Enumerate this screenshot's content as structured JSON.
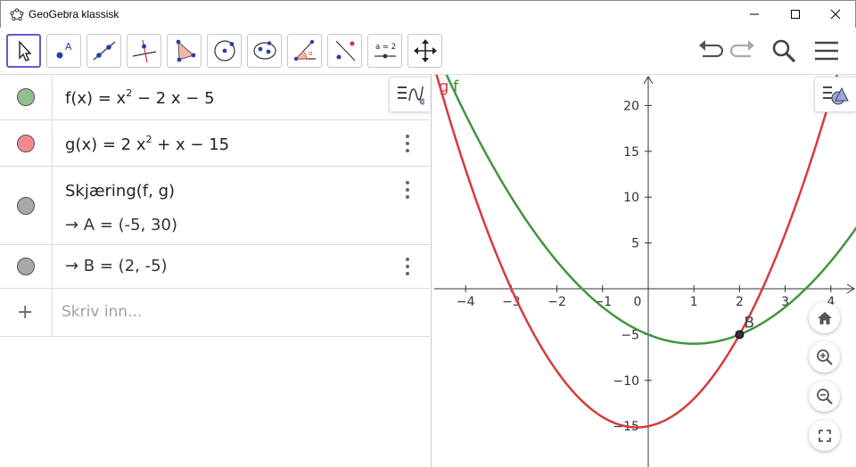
{
  "window": {
    "title": "GeoGebra klassisk"
  },
  "toolbar": {
    "tools": [
      {
        "name": "move-tool",
        "icon": "arrow-cursor-icon"
      },
      {
        "name": "point-tool",
        "icon": "point-icon"
      },
      {
        "name": "line-tool",
        "icon": "line-icon"
      },
      {
        "name": "perpendicular-line-tool",
        "icon": "perpendicular-icon"
      },
      {
        "name": "polygon-tool",
        "icon": "polygon-icon"
      },
      {
        "name": "circle-tool",
        "icon": "circle-icon"
      },
      {
        "name": "ellipse-tool",
        "icon": "ellipse-icon"
      },
      {
        "name": "angle-tool",
        "icon": "angle-icon"
      },
      {
        "name": "reflect-tool",
        "icon": "reflect-icon"
      },
      {
        "name": "slider-tool",
        "icon": "slider-icon",
        "label": "a = 2"
      },
      {
        "name": "move-graphics-tool",
        "icon": "move-view-icon"
      }
    ]
  },
  "algebra": {
    "rows": [
      {
        "color": "#90c08f",
        "name": "f",
        "expr_prefix": "f(x)  =  x",
        "expr_sup": "2",
        "expr_suffix": " − 2 x − 5"
      },
      {
        "color": "#f08b8b",
        "name": "g",
        "expr_prefix": "g(x)  =  2 x",
        "expr_sup": "2",
        "expr_suffix": " + x − 15"
      },
      {
        "color": "#a8a8a8",
        "name": "intersect",
        "expr": "Skjæring(f, g)",
        "result": "→ A = (-5, 30)"
      },
      {
        "color": "#a8a8a8",
        "name": "B",
        "expr": "→ B = (2, -5)"
      }
    ],
    "input_placeholder": "Skriv inn..."
  },
  "graphics": {
    "curve_labels": {
      "g": "g",
      "f": "f"
    },
    "point_label": "B",
    "x_ticks": [
      "−4",
      "−3",
      "−2",
      "−1",
      "0",
      "1",
      "2",
      "3",
      "4"
    ],
    "y_ticks": [
      "20",
      "15",
      "10",
      "5",
      "−5",
      "−10",
      "−15"
    ],
    "colors": {
      "f": "#3f9540",
      "g": "#d63b3b",
      "axis": "#333333"
    }
  },
  "chart_data": {
    "type": "line",
    "title": "",
    "xlabel": "",
    "ylabel": "",
    "xlim": [
      -4.7,
      4.5
    ],
    "ylim": [
      -19,
      23.2
    ],
    "series": [
      {
        "name": "f",
        "function": "x^2 - 2x - 5",
        "color": "#3f9540"
      },
      {
        "name": "g",
        "function": "2x^2 + x - 15",
        "color": "#d63b3b"
      }
    ],
    "points": [
      {
        "name": "B",
        "x": 2,
        "y": -5
      }
    ],
    "grid": false
  }
}
